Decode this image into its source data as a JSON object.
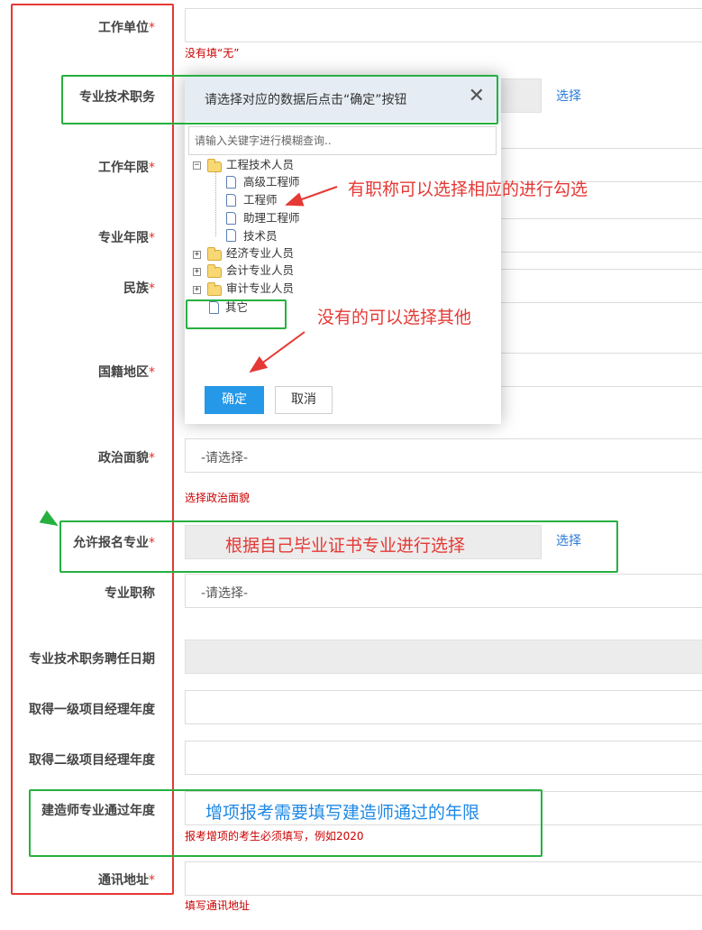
{
  "form": {
    "work_unit": {
      "label": "工作单位",
      "required": "*",
      "hint": "没有填“无”"
    },
    "tech_post": {
      "label": "专业技术职务",
      "link": "选择"
    },
    "work_years": {
      "label": "工作年限",
      "required": "*"
    },
    "major_years": {
      "label": "专业年限",
      "required": "*"
    },
    "ethnicity": {
      "label": "民族",
      "required": "*"
    },
    "nationality": {
      "label": "国籍地区",
      "required": "*"
    },
    "politics": {
      "label": "政治面貌",
      "required": "*",
      "value": "-请选择-",
      "hint": "选择政治面貌"
    },
    "allowed_major": {
      "label": "允许报名专业",
      "required": "*",
      "link": "选择"
    },
    "pro_title": {
      "label": "专业职称",
      "value": "-请选择-"
    },
    "hire_date": {
      "label": "专业技术职务聘任日期"
    },
    "pm1_year": {
      "label": "取得一级项目经理年度"
    },
    "pm2_year": {
      "label": "取得二级项目经理年度"
    },
    "constructor_year": {
      "label": "建造师专业通过年度",
      "hint": "报考增项的考生必须填写，例如2020"
    },
    "address": {
      "label": "通讯地址",
      "required": "*",
      "hint": "填写通讯地址"
    }
  },
  "dialog": {
    "title": "请选择对应的数据后点击“确定”按钮",
    "close": "✕",
    "search_placeholder": "请输入关键字进行模糊查询..",
    "tree": {
      "engineering": "工程技术人员",
      "senior_engineer": "高级工程师",
      "engineer": "工程师",
      "assistant_engineer": "助理工程师",
      "technician": "技术员",
      "economic": "经济专业人员",
      "accounting": "会计专业人员",
      "audit": "审计专业人员",
      "other": "其它",
      "expand": "+",
      "collapse": "−"
    },
    "ok": "确定",
    "cancel": "取消"
  },
  "annotations": {
    "select_title": "有职称可以选择相应的进行勾选",
    "select_other": "没有的可以选择其他",
    "select_major": "根据自己毕业证书专业进行选择",
    "constructor_note": "增项报考需要填写建造师通过的年限"
  },
  "colors": {
    "required": "#e03030",
    "hint": "#cc0000",
    "link": "#2d7bd6",
    "annot_red": "#e53935",
    "annot_blue": "#1e88e5",
    "green_box": "#26b040",
    "ok_button": "#2598e8"
  }
}
